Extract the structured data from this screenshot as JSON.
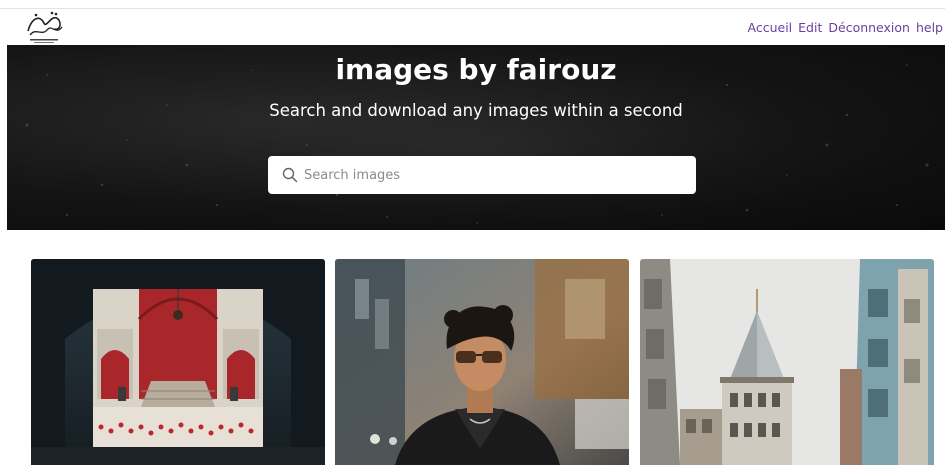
{
  "brand": {
    "logo_text": "فيروز"
  },
  "nav": {
    "links": [
      {
        "label": "Accueil"
      },
      {
        "label": "Edit"
      },
      {
        "label": "Déconnexion"
      },
      {
        "label": "help"
      }
    ]
  },
  "hero": {
    "title": "images by fairouz",
    "subtitle": "Search and download any images within a second",
    "search": {
      "placeholder": "Search images",
      "value": ""
    }
  },
  "gallery": {
    "images": [
      {
        "icon": "archway-courtyard-photo"
      },
      {
        "icon": "man-sunglasses-photo"
      },
      {
        "icon": "tower-street-photo"
      }
    ]
  },
  "colors": {
    "nav_link": "#6b3fa0",
    "hero_bg": "#141414",
    "search_bg": "#ffffff"
  }
}
